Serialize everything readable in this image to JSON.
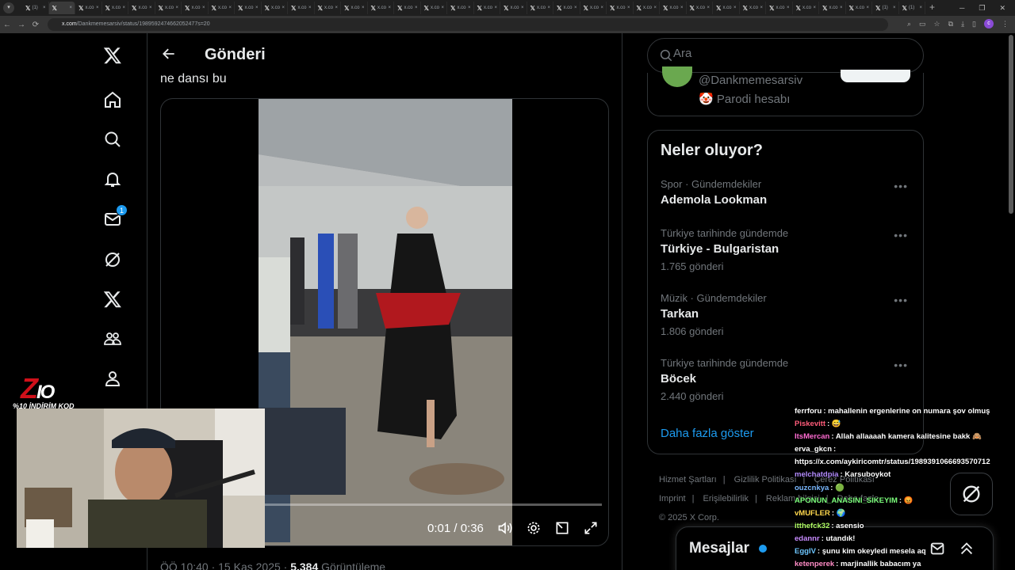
{
  "browser": {
    "tabs": [
      {
        "label": "(1)",
        "active": false
      },
      {
        "label": "",
        "active": true
      },
      {
        "label": "x.co",
        "active": false
      },
      {
        "label": "x.co",
        "active": false
      },
      {
        "label": "x.co",
        "active": false
      },
      {
        "label": "x.co",
        "active": false
      },
      {
        "label": "x.co",
        "active": false
      },
      {
        "label": "x.co",
        "active": false
      },
      {
        "label": "x.co",
        "active": false
      },
      {
        "label": "x.co",
        "active": false
      },
      {
        "label": "x.co",
        "active": false
      },
      {
        "label": "x.co",
        "active": false
      },
      {
        "label": "x.co",
        "active": false
      },
      {
        "label": "x.co",
        "active": false
      },
      {
        "label": "x.co",
        "active": false
      },
      {
        "label": "x.co",
        "active": false
      },
      {
        "label": "x.co",
        "active": false
      },
      {
        "label": "x.co",
        "active": false
      },
      {
        "label": "x.co",
        "active": false
      },
      {
        "label": "x.co",
        "active": false
      },
      {
        "label": "x.co",
        "active": false
      },
      {
        "label": "x.co",
        "active": false
      },
      {
        "label": "x.co",
        "active": false
      },
      {
        "label": "x.co",
        "active": false
      },
      {
        "label": "x.co",
        "active": false
      },
      {
        "label": "x.co",
        "active": false
      },
      {
        "label": "x.co",
        "active": false
      },
      {
        "label": "x.co",
        "active": false
      },
      {
        "label": "x.co",
        "active": false
      },
      {
        "label": "x.co",
        "active": false
      },
      {
        "label": "x.co",
        "active": false
      },
      {
        "label": "x.co",
        "active": false
      },
      {
        "label": "(1)",
        "active": false
      },
      {
        "label": "(1)",
        "active": false
      }
    ],
    "url_host": "x.com",
    "url_path": "/Dankmemesarsiv/status/1989592474662052477s=20",
    "profile_initial": "c"
  },
  "nav": {
    "messages_badge": "1"
  },
  "main": {
    "title": "Gönderi",
    "post_text": "ne dansı bu",
    "video": {
      "time": "0:01 / 0:36",
      "progress": 0.03
    },
    "meta_time": "ÖÖ 10:40 · 15 Kas 2025 · ",
    "meta_views_count": "5.384",
    "meta_views_label": " Görüntüleme"
  },
  "search": {
    "placeholder": "Ara"
  },
  "profile": {
    "handle": "@Dankmemesarsiv",
    "parody": "Parodi hesabı",
    "parody_emoji": "🤡"
  },
  "trends": {
    "title": "Neler oluyor?",
    "items": [
      {
        "context": "Spor · Gündemdekiler",
        "name": "Ademola Lookman",
        "count": ""
      },
      {
        "context": "Türkiye tarihinde gündemde",
        "name": "Türkiye - Bulgaristan",
        "count": "1.765 gönderi"
      },
      {
        "context": "Müzik · Gündemdekiler",
        "name": "Tarkan",
        "count": "1.806 gönderi"
      },
      {
        "context": "Türkiye tarihinde gündemde",
        "name": "Böcek",
        "count": "2.440 gönderi"
      }
    ],
    "show_more": "Daha fazla göster"
  },
  "footer": {
    "row1": [
      "Hizmet Şartları",
      "Gizlilik Politikası",
      "Çerez Politikası"
    ],
    "row2": [
      "Imprint",
      "Erişilebilirlik",
      "Reklam bilgisi",
      "Daha fazla"
    ],
    "copyright": "© 2025 X Corp."
  },
  "messages": {
    "title": "Mesajlar"
  },
  "overlay": {
    "logo_z": "Z",
    "logo_io": "IO",
    "promo": "%10 İNDİRİM KOD",
    "chat": [
      {
        "user": "ferrforu",
        "color": "#ffffff",
        "text": "mahallenin ergenlerine on numara şov olmuş"
      },
      {
        "user": "Piskevitt",
        "color": "#ff5c7a",
        "text": "😅"
      },
      {
        "user": "ItsMercan",
        "color": "#ff6bd1",
        "text": "Allah allaaaah kamera kalitesine bakk 🙈"
      },
      {
        "user": "erva_gkcn",
        "color": "#ffffff",
        "text": ""
      },
      {
        "user": "",
        "color": "#ffffff",
        "text": "https://x.com/aykiricomtr/status/1989391066693570712"
      },
      {
        "user": "melchatdpia",
        "color": "#b48cff",
        "text": "Karsuboykot"
      },
      {
        "user": "ouzcnkya",
        "color": "#7ab8ff",
        "text": "🟢"
      },
      {
        "user": "APONUN_ANASINI_SIKEYIM",
        "color": "#7cff7c",
        "text": "😡"
      },
      {
        "user": "vMUFLER",
        "color": "#ffd84d",
        "text": "🌍"
      },
      {
        "user": "itthefck32",
        "color": "#b2ff66",
        "text": "asensio"
      },
      {
        "user": "edannr",
        "color": "#c88cff",
        "text": "utandık!"
      },
      {
        "user": "EggIV",
        "color": "#6ec6ff",
        "text": "şunu kim okeyledi mesela aq"
      },
      {
        "user": "ketenperek",
        "color": "#ff8cc6",
        "text": "marjinallik babacım ya"
      }
    ]
  },
  "colors": {
    "accent": "#1d9bf0",
    "background": "#000000",
    "text": "#e7e9ea",
    "muted": "#71767b",
    "border": "#2f3336"
  }
}
